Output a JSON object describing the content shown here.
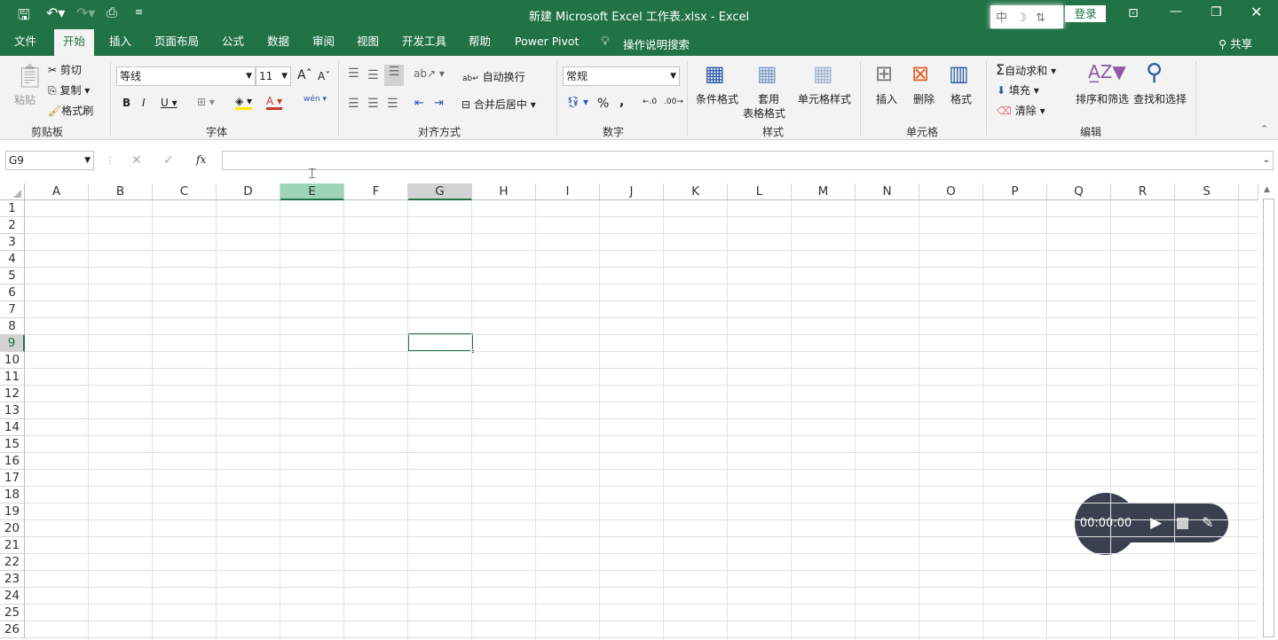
{
  "title": "新建 Microsoft Excel 工作表.xlsx  -  Excel",
  "login": "登录",
  "ime": [
    "中",
    "☽",
    "⇅"
  ],
  "tabs": [
    "文件",
    "开始",
    "插入",
    "页面布局",
    "公式",
    "数据",
    "审阅",
    "视图",
    "开发工具",
    "帮助",
    "Power Pivot"
  ],
  "tell_me": "操作说明搜索",
  "share": "共享",
  "clipboard": {
    "paste": "粘贴",
    "cut": "剪切",
    "copy": "复制",
    "painter": "格式刷",
    "group": "剪贴板"
  },
  "font": {
    "name": "等线",
    "size": "11",
    "bold": "B",
    "italic": "I",
    "underline": "U",
    "phonetic": "wén",
    "group": "字体"
  },
  "align": {
    "wrap": "自动换行",
    "merge": "合并后居中",
    "group": "对齐方式"
  },
  "number": {
    "format": "常规",
    "percent": "%",
    "comma": ",",
    "group": "数字"
  },
  "styles": {
    "conditional": "条件格式",
    "table1": "套用",
    "table2": "表格格式",
    "cell": "单元格样式",
    "group": "样式"
  },
  "cells": {
    "insert": "插入",
    "delete": "删除",
    "format": "格式",
    "group": "单元格"
  },
  "editing": {
    "autosum": "自动求和",
    "fill": "填充",
    "clear": "清除",
    "sort": "排序和筛选",
    "find": "查找和选择",
    "group": "编辑"
  },
  "namebox": "G9",
  "formula": "",
  "columns": [
    "A",
    "B",
    "C",
    "D",
    "E",
    "F",
    "G",
    "H",
    "I",
    "J",
    "K",
    "L",
    "M",
    "N",
    "O",
    "P",
    "Q",
    "R",
    "S"
  ],
  "rows": [
    "1",
    "2",
    "3",
    "4",
    "5",
    "6",
    "7",
    "8",
    "9",
    "10",
    "11",
    "12",
    "13",
    "14",
    "15",
    "16",
    "17",
    "18",
    "19",
    "20",
    "21",
    "22",
    "23",
    "24",
    "25",
    "26"
  ],
  "selected_col": "G",
  "selected_row": "9",
  "hover_col": "E",
  "recorder": {
    "time": "00:00:00"
  },
  "colors": {
    "accent": "#217346",
    "recorder": "#3b4050"
  }
}
